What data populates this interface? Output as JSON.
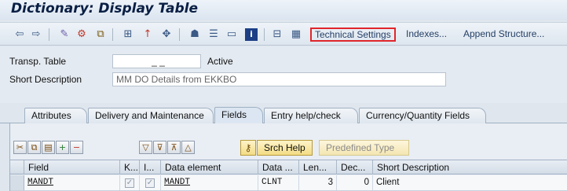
{
  "window": {
    "title": "Dictionary: Display Table"
  },
  "toolbar": {
    "icons": [
      "back-arrow-icon",
      "forward-arrow-icon",
      "display-change-icon",
      "other-object-icon",
      "activate-icon",
      "check-icon",
      "where-used-icon",
      "object-list-icon",
      "navigate-icon",
      "hierarchy-icon",
      "print-icon",
      "layout-icon",
      "info-icon",
      "graphics-icon",
      "table-view-icon"
    ],
    "technical_settings_label": "Technical Settings",
    "indexes_label": "Indexes...",
    "append_structure_label": "Append Structure..."
  },
  "header": {
    "transp_table_label": "Transp. Table",
    "transp_table_value": "_ _",
    "status": "Active",
    "short_description_label": "Short Description",
    "short_description_value": "MM DO Details from EKKBO"
  },
  "tabs": [
    {
      "label": "Attributes",
      "active": false
    },
    {
      "label": "Delivery and Maintenance",
      "active": false
    },
    {
      "label": "Fields",
      "active": true
    },
    {
      "label": "Entry help/check",
      "active": false
    },
    {
      "label": "Currency/Quantity Fields",
      "active": false
    }
  ],
  "grid_toolbar": {
    "srch_help_label": "Srch Help",
    "predefined_type_label": "Predefined Type"
  },
  "grid": {
    "columns": [
      "Field",
      "K...",
      "I...",
      "Data element",
      "Data ...",
      "Len...",
      "Dec...",
      "Short Description"
    ],
    "rows": [
      {
        "field": "MANDT",
        "key": true,
        "initial": true,
        "data_element": "MANDT",
        "data_type": "CLNT",
        "length": "3",
        "decimals": "0",
        "short_description": "Client"
      }
    ]
  }
}
